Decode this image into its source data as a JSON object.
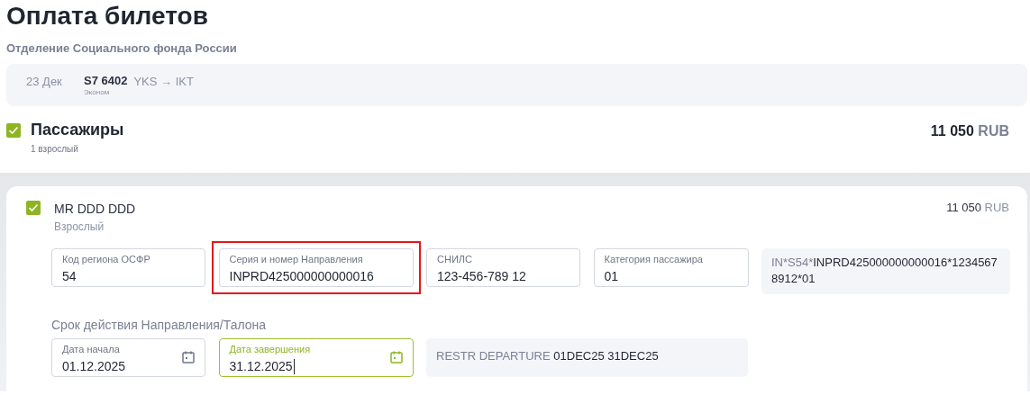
{
  "title": "Оплата билетов",
  "subtitle": "Отделение Социального фонда России",
  "flight": {
    "date": "23 Дек",
    "number": "S7 6402",
    "class": "Эконом",
    "route": "YKS → IKT"
  },
  "passengers": {
    "title": "Пассажиры",
    "checked": true,
    "count": "1 взрослый",
    "amount": "11 050",
    "currency": "RUB"
  },
  "passenger": {
    "name": "MR DDD DDD",
    "type": "Взрослый",
    "checked": true,
    "amount": "11 050",
    "currency": "RUB",
    "fields": [
      {
        "kind": "text",
        "label": "Код региона ОСФР",
        "value": "54",
        "highlighted": false,
        "focused": false
      },
      {
        "kind": "text",
        "label": "Серия и номер Направления",
        "value": "INPRD425000000000016",
        "highlighted": true,
        "focused": false
      },
      {
        "kind": "text",
        "label": "СНИЛС",
        "value": "123-456-789 12",
        "highlighted": false,
        "focused": false
      },
      {
        "kind": "text",
        "label": "Категория пассажира",
        "value": "01",
        "highlighted": false,
        "focused": false
      }
    ],
    "ssr": {
      "prefix": "IN*S54*",
      "value": "INPRD425000000000016*12345678912*01"
    },
    "validity_label": "Срок действия Направления/Талона",
    "dates": [
      {
        "kind": "date",
        "label": "Дата начала",
        "value": "01.12.2025",
        "highlighted": false,
        "focused": false
      },
      {
        "kind": "date",
        "label": "Дата завершения",
        "value": "31.12.2025",
        "highlighted": false,
        "focused": true
      }
    ],
    "restriction": {
      "prefix": "RESTR DEPARTURE",
      "value": "01DEC25 31DEC25"
    }
  }
}
